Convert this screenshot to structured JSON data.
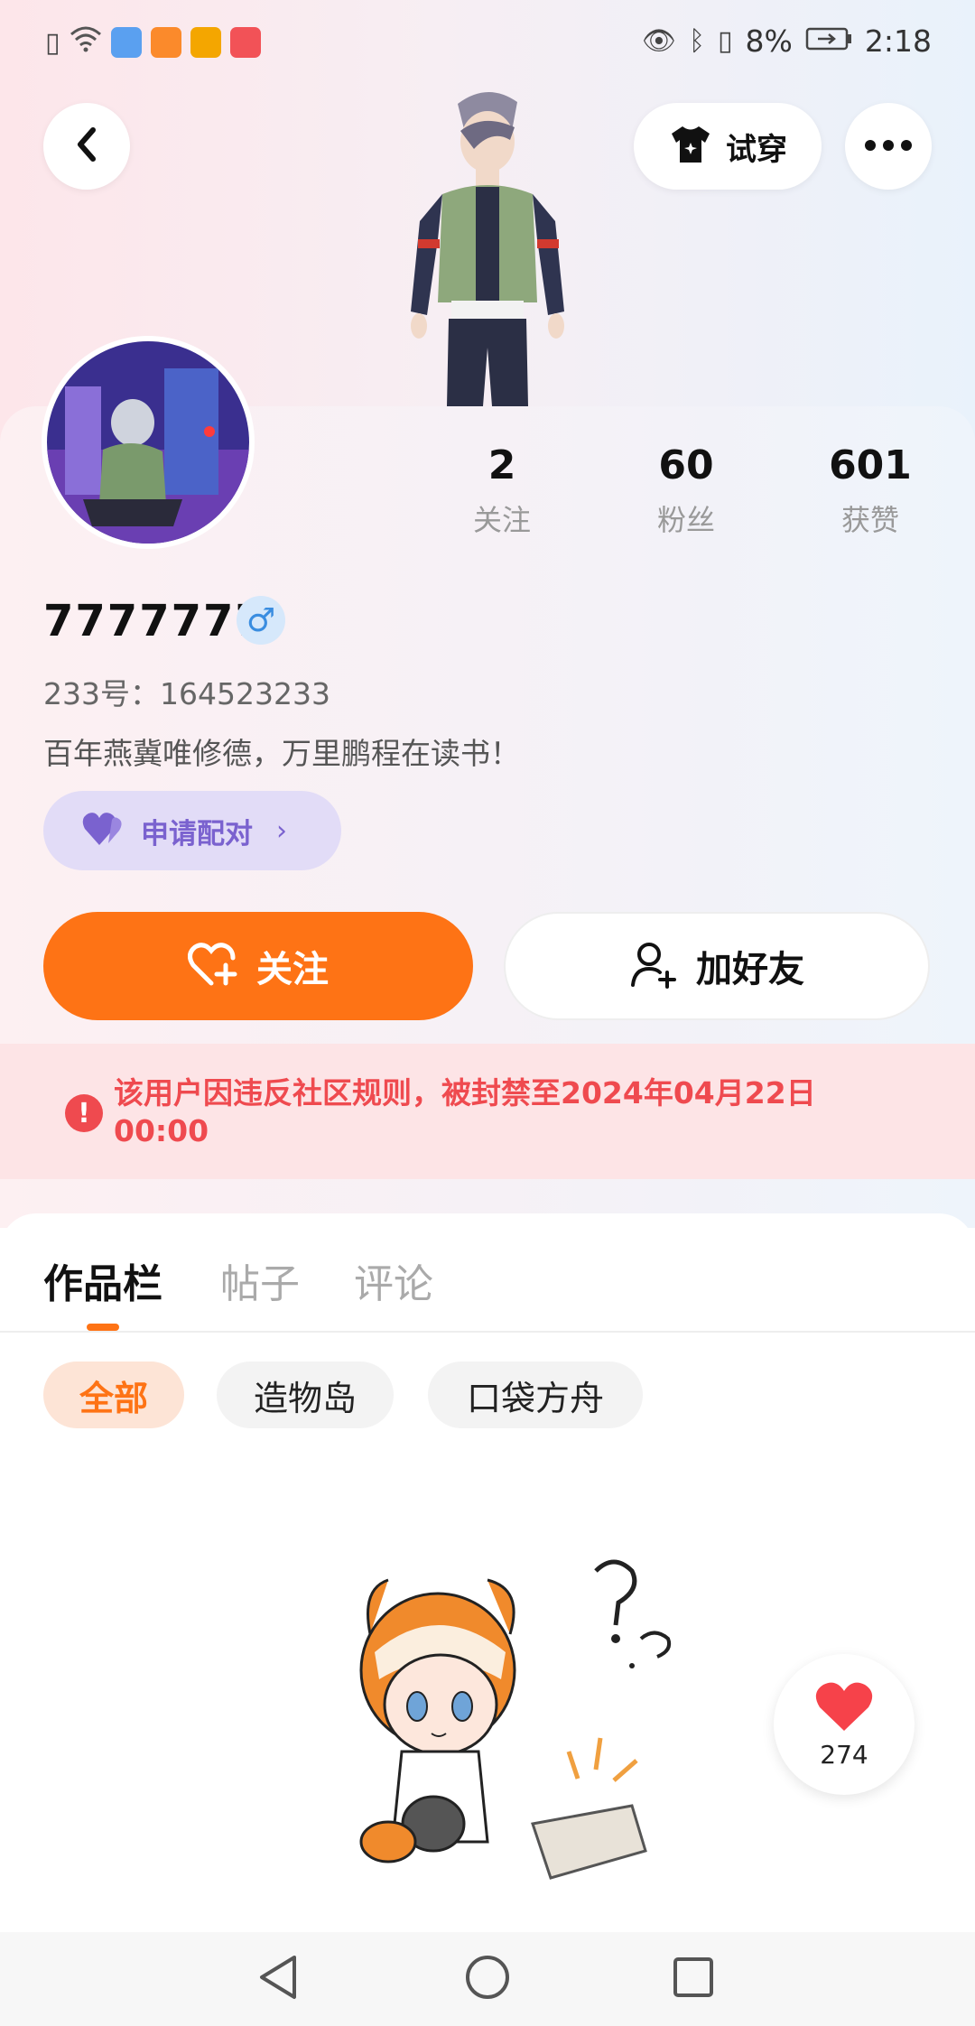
{
  "status_bar": {
    "battery": "8%",
    "time": "2:18",
    "app_icon_colors": [
      "#5aa0f0",
      "#fb8a2b",
      "#f4a600",
      "#f25257"
    ]
  },
  "header": {
    "back_icon": "chevron-left-icon",
    "try_on_label": "试穿",
    "more_icon": "more-horizontal-icon"
  },
  "stats": [
    {
      "value": "2",
      "label": "关注"
    },
    {
      "value": "60",
      "label": "粉丝"
    },
    {
      "value": "601",
      "label": "获赞"
    }
  ],
  "profile": {
    "username": "7777777",
    "gender_symbol": "♂",
    "uid_label": "233号：164523233",
    "bio": "百年燕冀唯修德，万里鹏程在读书！",
    "pair_label": "申请配对"
  },
  "actions": {
    "follow_label": "关注",
    "add_friend_label": "加好友"
  },
  "ban_notice": "该用户因违反社区规则，被封禁至2024年04月22日 00:00",
  "tabs": [
    {
      "label": "作品栏",
      "active": true
    },
    {
      "label": "帖子",
      "active": false
    },
    {
      "label": "评论",
      "active": false
    }
  ],
  "filters": [
    {
      "label": "全部",
      "active": true
    },
    {
      "label": "造物岛",
      "active": false
    },
    {
      "label": "口袋方舟",
      "active": false
    }
  ],
  "like_count": "274",
  "colors": {
    "accent": "#fe7315",
    "ban_red": "#ef4a4f",
    "pair_purple": "#7a62cf"
  }
}
